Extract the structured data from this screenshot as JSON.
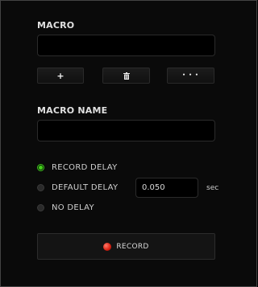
{
  "macro": {
    "title": "MACRO",
    "selected_value": "",
    "buttons": {
      "add_label": "+",
      "delete_icon": "trash-icon",
      "more_label": "• • •"
    }
  },
  "macro_name": {
    "title": "MACRO NAME",
    "value": ""
  },
  "delay": {
    "options": [
      {
        "label": "RECORD DELAY",
        "selected": true
      },
      {
        "label": "DEFAULT DELAY",
        "selected": false
      },
      {
        "label": "NO DELAY",
        "selected": false
      }
    ],
    "default_delay_value": "0.050",
    "unit": "sec"
  },
  "record": {
    "label": "RECORD"
  },
  "colors": {
    "selected_radio": "#44d11a",
    "record_dot": "#d81f10",
    "background": "#0a0a0a"
  }
}
